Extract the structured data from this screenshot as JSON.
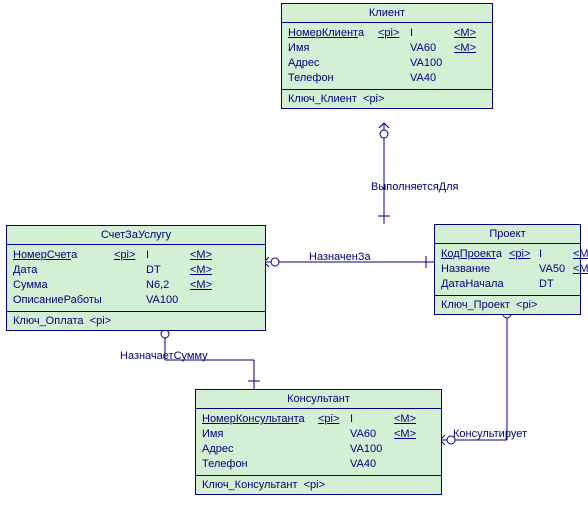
{
  "entities": {
    "client": {
      "title": "Клиент",
      "a": [
        {
          "n": "НомерКлиент",
          "suf": "а",
          "pi": "<pi>",
          "t": "I",
          "m": "<M>",
          "u": true
        },
        {
          "n": "Имя",
          "t": "VA60",
          "m": "<M>"
        },
        {
          "n": "Адрес",
          "t": "VA100"
        },
        {
          "n": "Телефон",
          "t": "VA40"
        }
      ],
      "key": "Ключ_Клиент",
      "kpi": "<pi>"
    },
    "project": {
      "title": "Проект",
      "a": [
        {
          "n": "КодПроект",
          "suf": "а",
          "pi": "<pi>",
          "t": "I",
          "m": "<M>",
          "u": true
        },
        {
          "n": "Название",
          "t": "VA50",
          "m": "<M>"
        },
        {
          "n": "ДатаНачала",
          "t": "DT"
        }
      ],
      "key": "Ключ_Проект",
      "kpi": "<pi>"
    },
    "invoice": {
      "title": "СчетЗаУслугу",
      "a": [
        {
          "n": "НомерСчет",
          "suf": "а",
          "pi": "<pi>",
          "t": "I",
          "m": "<M>",
          "u": true
        },
        {
          "n": "Дата",
          "t": "DT",
          "m": "<M>"
        },
        {
          "n": "Сумма",
          "t": "N6,2",
          "m": "<M>"
        },
        {
          "n": "ОписаниеРаботы",
          "t": "VA100"
        }
      ],
      "key": "Ключ_Оплата",
      "kpi": "<pi>"
    },
    "consultant": {
      "title": "Консультант",
      "a": [
        {
          "n": "НомерКонсультант",
          "suf": "а",
          "pi": "<pi>",
          "t": "I",
          "m": "<M>",
          "u": true
        },
        {
          "n": "Имя",
          "t": "VA60",
          "m": "<M>"
        },
        {
          "n": "Адрес",
          "t": "VA100"
        },
        {
          "n": "Телефон",
          "t": "VA40"
        }
      ],
      "key": "Ключ_Консультант",
      "kpi": "<pi>"
    }
  },
  "rels": {
    "r1": "ВыполняетсяДля",
    "r2": "НазначенЗа",
    "r3": "НазначаетСумму",
    "r4": "Консультирует"
  }
}
